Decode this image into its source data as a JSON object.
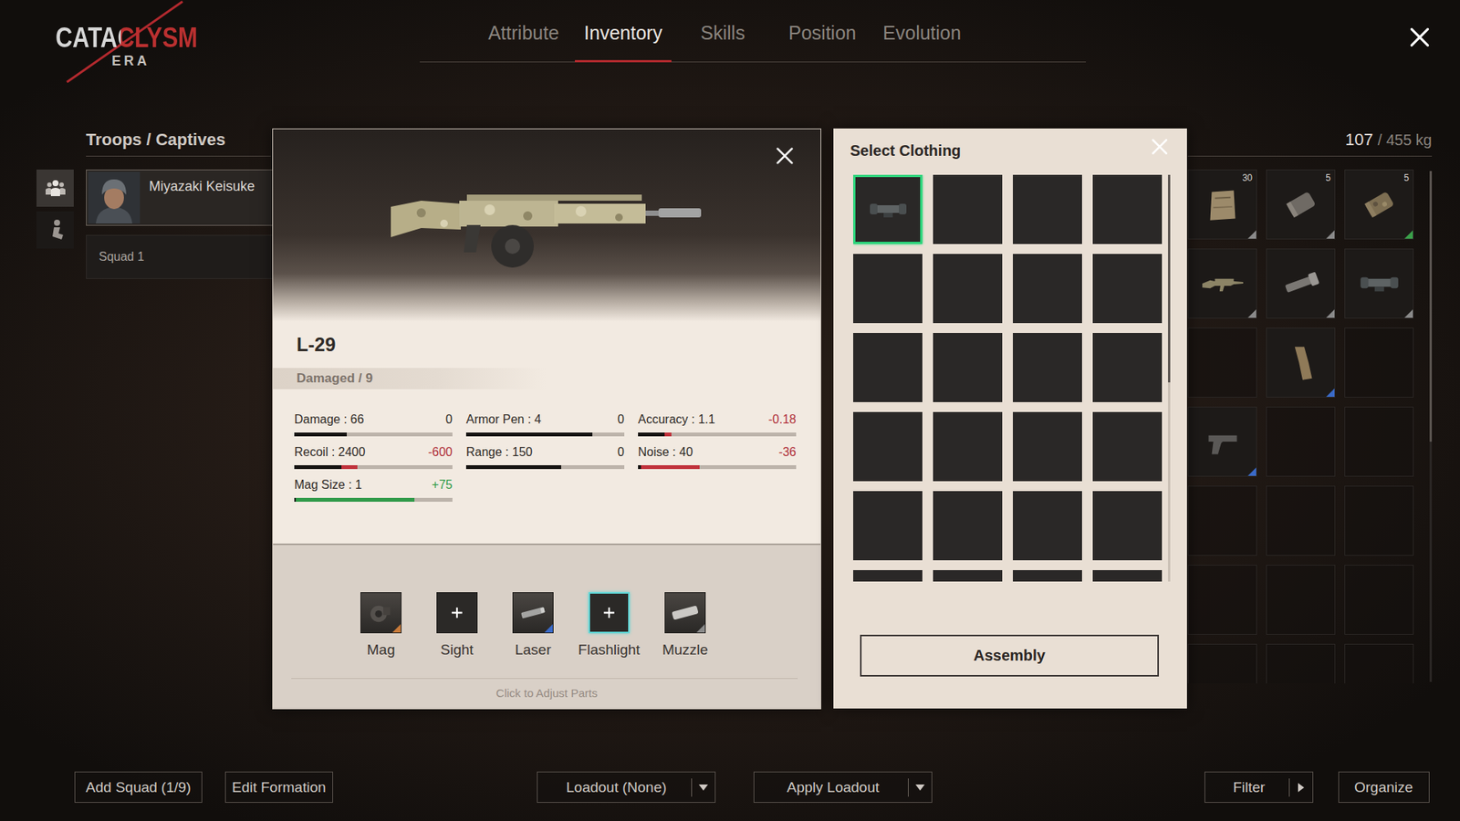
{
  "logo": {
    "title": "CATACLYSM",
    "subtitle": "ERA"
  },
  "tabs": [
    {
      "label": "Attribute",
      "selected": false
    },
    {
      "label": "Inventory",
      "selected": true
    },
    {
      "label": "Skills",
      "selected": false
    },
    {
      "label": "Position",
      "selected": false
    },
    {
      "label": "Evolution",
      "selected": false
    }
  ],
  "sidebar": {
    "title": "Troops / Captives",
    "modes": [
      {
        "kind": "troops",
        "selected": true
      },
      {
        "kind": "captives",
        "selected": false
      }
    ],
    "troops": [
      {
        "name": "Miyazaki Keisuke",
        "selected": true
      }
    ],
    "squads": [
      {
        "name": "Squad 1"
      }
    ]
  },
  "inventory": {
    "weight_current": "107",
    "weight_max": "/ 455 kg",
    "scrollbar": {
      "level": 0.53
    },
    "cells": [
      {
        "kind": "bag",
        "count": "30",
        "color": "#8a8a8a"
      },
      {
        "kind": "canister",
        "count": "5",
        "color": "#8a8a8a"
      },
      {
        "kind": "canister_camo",
        "count": "5",
        "color": "#3aa04a"
      },
      {
        "kind": "rifle",
        "color": "#8a8a8a"
      },
      {
        "kind": "flashlight",
        "color": "#8a8a8a"
      },
      {
        "kind": "scope",
        "color": "#8a8a8a"
      },
      {
        "kind": "empty"
      },
      {
        "kind": "mag",
        "color": "#3a6ac8"
      },
      {
        "kind": "empty"
      },
      {
        "kind": "pistol",
        "color": "#3a6ac8"
      },
      {
        "kind": "empty"
      },
      {
        "kind": "empty"
      },
      {
        "kind": "empty"
      },
      {
        "kind": "empty"
      },
      {
        "kind": "empty"
      },
      {
        "kind": "empty"
      },
      {
        "kind": "empty"
      },
      {
        "kind": "empty"
      },
      {
        "kind": "empty"
      },
      {
        "kind": "empty"
      },
      {
        "kind": "empty"
      }
    ]
  },
  "weapon": {
    "name": "L-29",
    "condition": "Damaged / 9",
    "stats": [
      {
        "label": "Damage : 66",
        "delta": "0",
        "level": 0.33,
        "delta_level": 0,
        "delta_kind": "none"
      },
      {
        "label": "Armor Pen : 4",
        "delta": "0",
        "level": 0.8,
        "delta_level": 0,
        "delta_kind": "none"
      },
      {
        "label": "Accuracy : 1.1",
        "delta": "-0.18",
        "level": 0.17,
        "delta_level": 0.04,
        "delta_kind": "loss"
      },
      {
        "label": "Recoil : 2400",
        "delta": "-600",
        "level": 0.3,
        "delta_level": 0.1,
        "delta_kind": "loss"
      },
      {
        "label": "Range : 150",
        "delta": "0",
        "level": 0.6,
        "delta_level": 0,
        "delta_kind": "none"
      },
      {
        "label": "Noise : 40",
        "delta": "-36",
        "level": 0.02,
        "delta_level": 0.37,
        "delta_kind": "loss"
      },
      {
        "label": "Mag Size : 1",
        "delta": "+75",
        "level": 0.01,
        "delta_level": 0.75,
        "delta_kind": "gain"
      }
    ],
    "parts": [
      {
        "label": "Mag",
        "kind": "drum",
        "color": "#c87a3a",
        "selected": false
      },
      {
        "label": "Sight",
        "kind": "empty",
        "selected": false
      },
      {
        "label": "Laser",
        "kind": "laser",
        "color": "#3a6ac8",
        "selected": false
      },
      {
        "label": "Flashlight",
        "kind": "empty",
        "selected": true
      },
      {
        "label": "Muzzle",
        "kind": "muzzle",
        "color": "#8a8a8a",
        "selected": false
      }
    ],
    "hint": "Click to Adjust Parts"
  },
  "clothing": {
    "title": "Select Clothing",
    "button": "Assembly",
    "scrollbar": {
      "level": 0.51
    },
    "cells": [
      {
        "kind": "scope",
        "selected": true
      },
      {
        "kind": "empty",
        "selected": false
      },
      {
        "kind": "empty",
        "selected": false
      },
      {
        "kind": "empty",
        "selected": false
      },
      {
        "kind": "empty",
        "selected": false
      },
      {
        "kind": "empty",
        "selected": false
      },
      {
        "kind": "empty",
        "selected": false
      },
      {
        "kind": "empty",
        "selected": false
      },
      {
        "kind": "empty",
        "selected": false
      },
      {
        "kind": "empty",
        "selected": false
      },
      {
        "kind": "empty",
        "selected": false
      },
      {
        "kind": "empty",
        "selected": false
      },
      {
        "kind": "empty",
        "selected": false
      },
      {
        "kind": "empty",
        "selected": false
      },
      {
        "kind": "empty",
        "selected": false
      },
      {
        "kind": "empty",
        "selected": false
      },
      {
        "kind": "empty",
        "selected": false
      },
      {
        "kind": "empty",
        "selected": false
      },
      {
        "kind": "empty",
        "selected": false
      },
      {
        "kind": "empty",
        "selected": false
      },
      {
        "kind": "empty",
        "selected": false
      },
      {
        "kind": "empty",
        "selected": false
      },
      {
        "kind": "empty",
        "selected": false
      },
      {
        "kind": "empty",
        "selected": false
      }
    ]
  },
  "bottom_bar": {
    "add_squad": "Add Squad (1/9)",
    "edit_formation": "Edit Formation",
    "loadout": "Loadout (None)",
    "apply_loadout": "Apply Loadout",
    "filter": "Filter",
    "organize": "Organize"
  }
}
